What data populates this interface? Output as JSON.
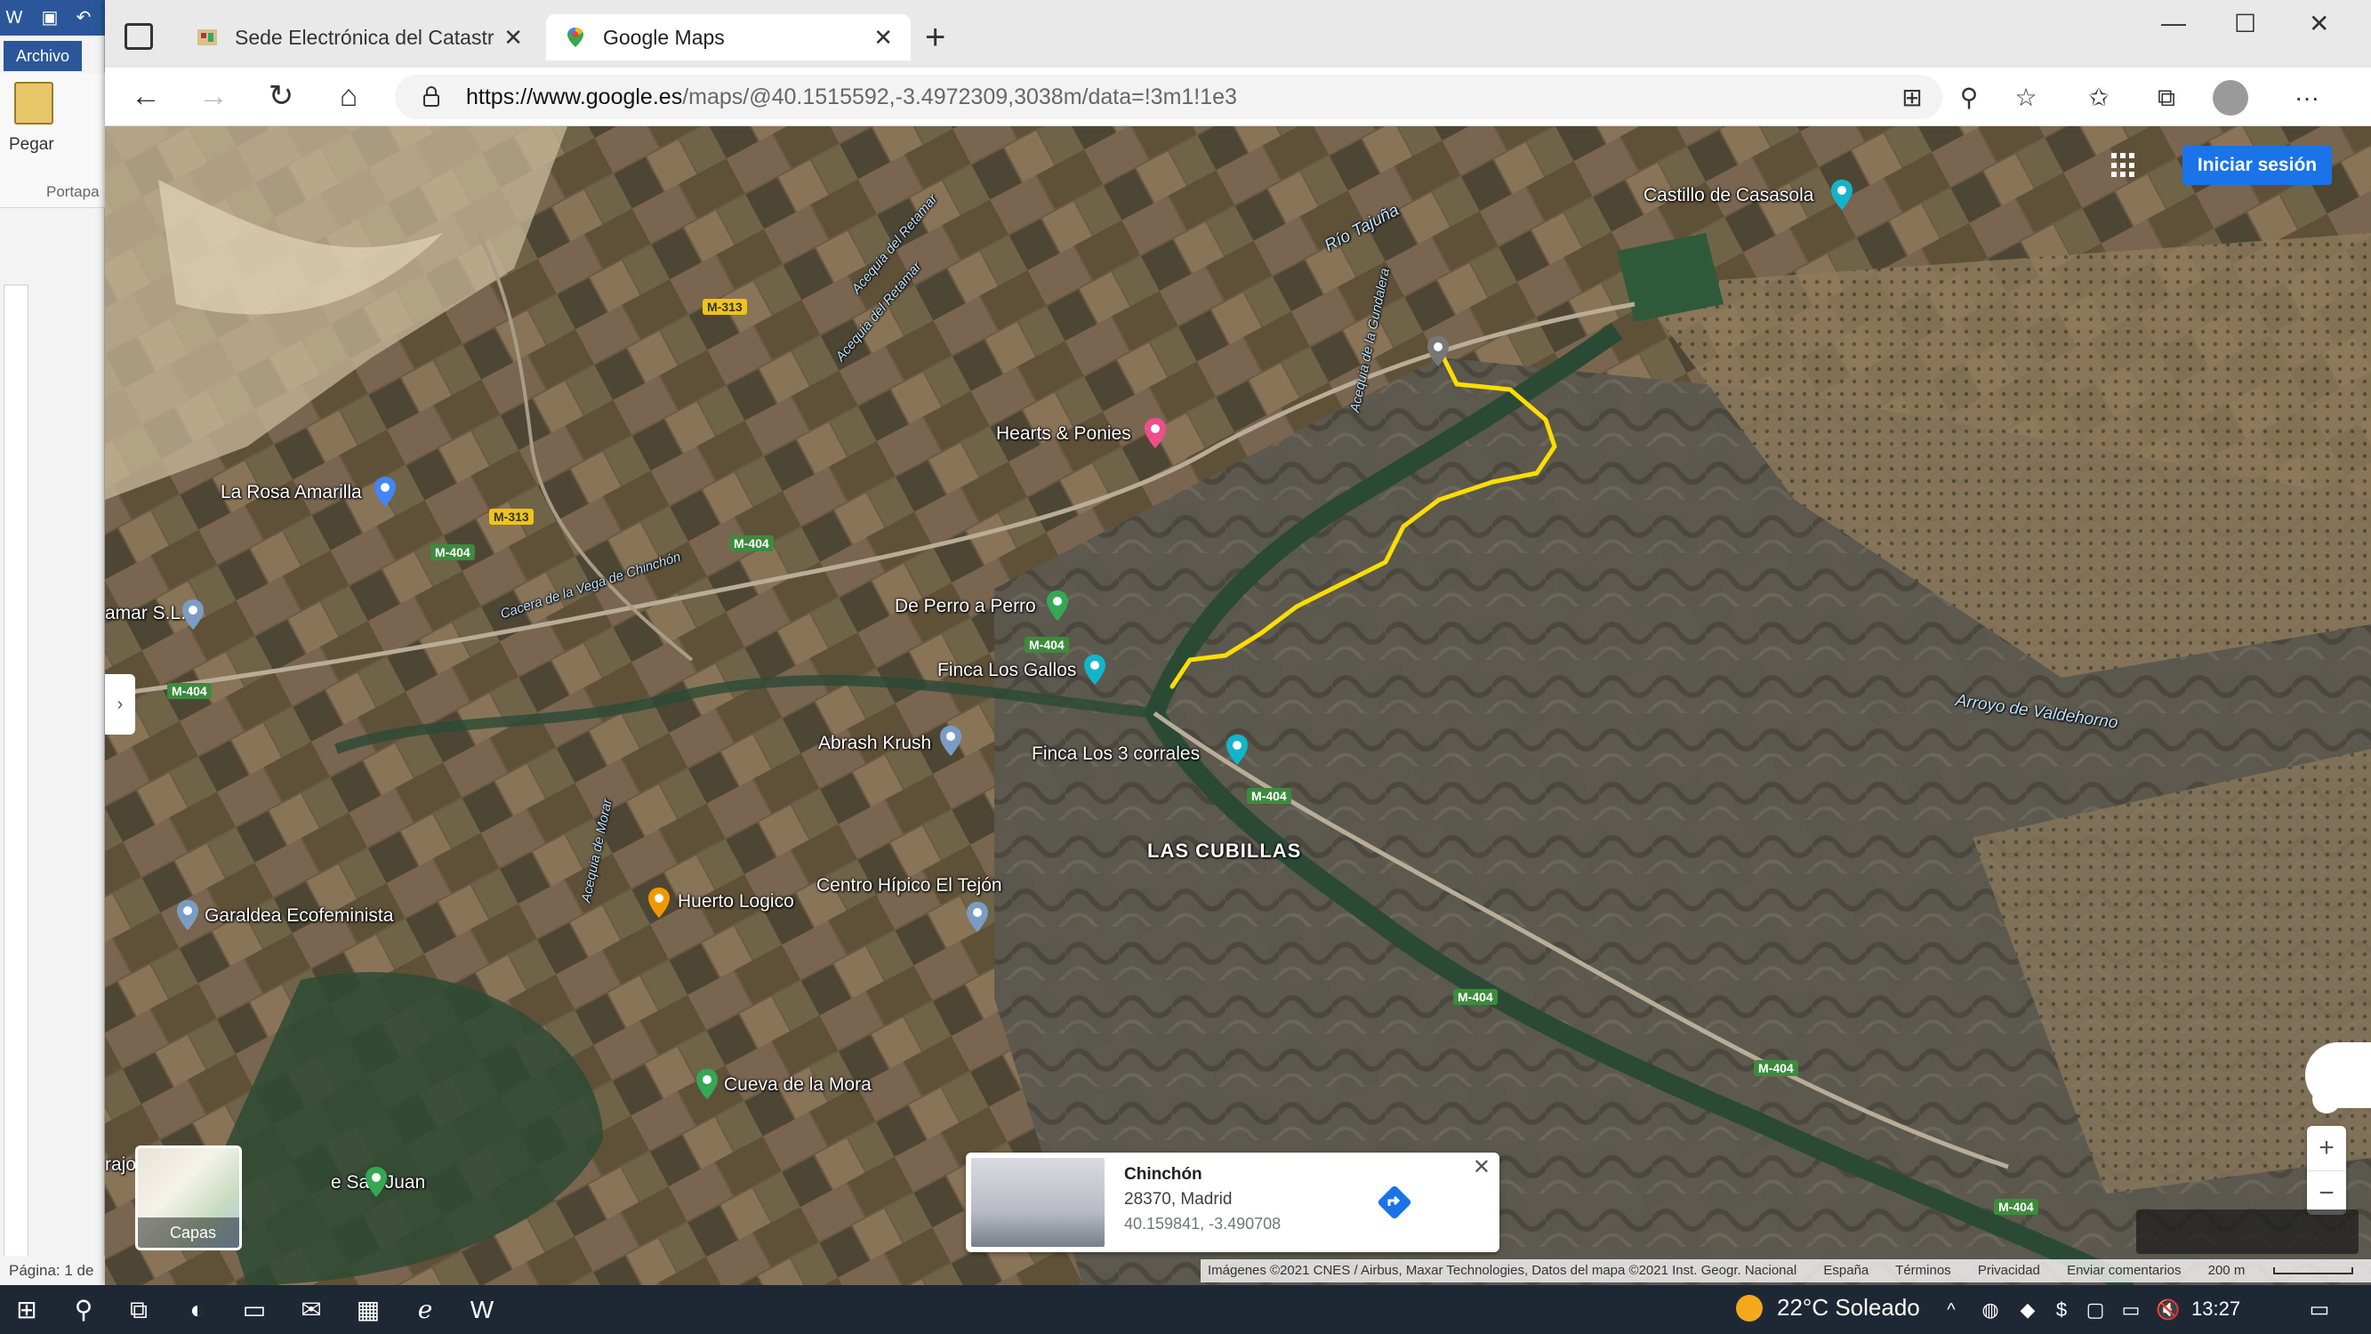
{
  "word": {
    "archivo": "Archivo",
    "paste": "Pegar",
    "clipboard": "Portapa",
    "status": "Página: 1 de"
  },
  "browser": {
    "tabs": [
      {
        "label": "Sede Electrónica del Catastro - F",
        "active": false
      },
      {
        "label": "Google Maps",
        "active": true
      }
    ],
    "url_host": "https://www.google.es",
    "url_path": "/maps/@40.1515592,-3.4972309,3038m/data=!3m1!1e3"
  },
  "map": {
    "signin": "Iniciar sesión",
    "places": [
      {
        "name": "Castillo de Casasola"
      },
      {
        "name": "Hearts & Ponies"
      },
      {
        "name": "La Rosa Amarilla"
      },
      {
        "name": "amar S.L."
      },
      {
        "name": "De Perro a Perro"
      },
      {
        "name": "Finca Los Gallos"
      },
      {
        "name": "Abrash Krush"
      },
      {
        "name": "Finca Los 3 corrales"
      },
      {
        "name": "Garaldea Ecofeminista"
      },
      {
        "name": "Huerto Logico"
      },
      {
        "name": "Centro Hípico El Tejón"
      },
      {
        "name": "Cueva de la Mora"
      },
      {
        "name": "e San Juan"
      },
      {
        "name": "rajo"
      }
    ],
    "town": "LAS CUBILLAS",
    "water": [
      {
        "name": "Río Tajuña"
      },
      {
        "name": "Acequia del Retamar"
      },
      {
        "name": "Acequia del Retamar"
      },
      {
        "name": "Acequia de la Gundalera"
      },
      {
        "name": "Cacera de la Vega de Chinchón"
      },
      {
        "name": "Acequia de Morar"
      },
      {
        "name": "Arroyo de Valdehorno"
      }
    ],
    "roads": [
      "M-313",
      "M-313",
      "M-404",
      "M-404",
      "M-404",
      "M-404",
      "M-404",
      "M-404",
      "M-404",
      "M-404"
    ],
    "layers_label": "Capas",
    "info_card": {
      "title": "Chinchón",
      "address": "28370, Madrid",
      "coords": "40.159841, -3.490708"
    },
    "attribution": [
      "Imágenes ©2021 CNES / Airbus, Maxar Technologies, Datos del mapa ©2021 Inst. Geogr. Nacional",
      "España",
      "Términos",
      "Privacidad",
      "Enviar comentarios"
    ],
    "scale": "200 m"
  },
  "taskbar": {
    "weather": "22°C  Soleado",
    "time": "13:27"
  }
}
